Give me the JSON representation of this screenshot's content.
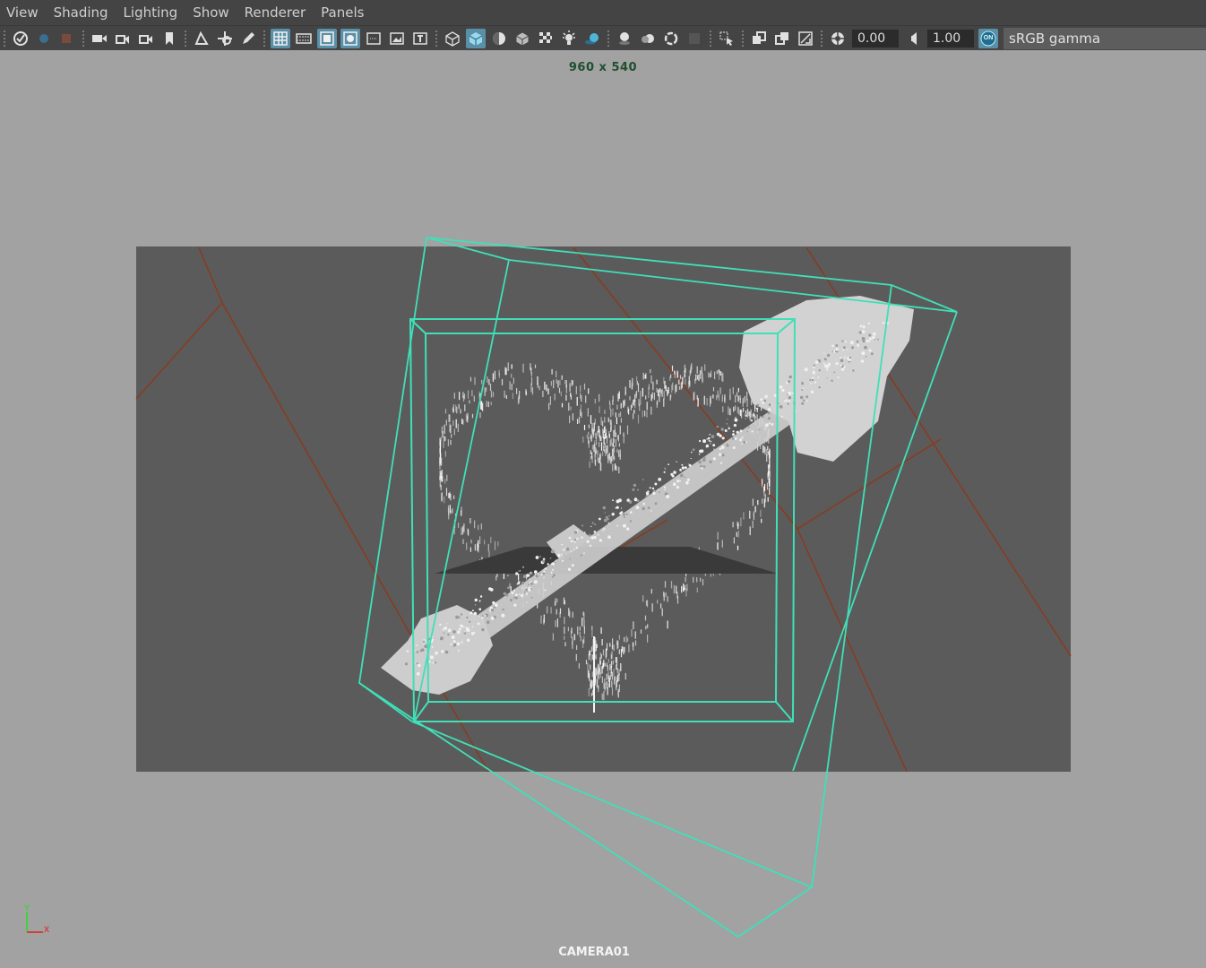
{
  "menu": [
    "View",
    "Shading",
    "Lighting",
    "Show",
    "Renderer",
    "Panels"
  ],
  "toolbar": {
    "exposure_value": "0.00",
    "gamma_value": "1.00",
    "color_management_badge": "ON",
    "color_space": "sRGB gamma",
    "icons": [
      "select-camera-icon",
      "camera-icon",
      "camera-attributes-icon",
      "bookmark-icon",
      "image-plane-icon",
      "2d-pan-zoom-icon",
      "grease-pencil-icon",
      "grid-icon",
      "film-gate-icon",
      "resolution-gate-icon",
      "gate-mask-icon",
      "field-chart-icon",
      "safe-action-icon",
      "safe-title-icon",
      "wireframe-icon",
      "smooth-shade-icon",
      "wireframe-on-shaded-icon",
      "textured-icon",
      "xray-icon",
      "lights-icon",
      "shadows-icon",
      "screen-space-ao-icon",
      "motion-blur-icon",
      "anti-aliasing-icon",
      "depth-of-field-icon",
      "isolate-select-icon",
      "xray-joints-icon",
      "xray-active-icon",
      "backface-culling-icon",
      "exposure-icon",
      "gamma-icon"
    ]
  },
  "viewport": {
    "resolution_label": "960 x 540",
    "camera_label": "CAMERA01",
    "axis": {
      "y": "Y",
      "x": "X"
    }
  },
  "colors": {
    "background": "#a2a2a2",
    "gate": "#5b5b5b",
    "wire": "#3fe0b8",
    "ground_lines": "#8a3a1e",
    "particles": "#e8e8e8"
  }
}
